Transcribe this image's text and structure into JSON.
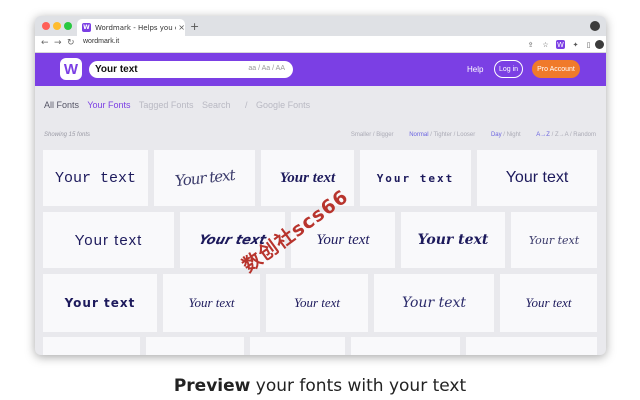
{
  "browser": {
    "tab_title": "Wordmark - Helps you choose",
    "tab_close": "×",
    "new_tab": "+",
    "url": "wordmark.it",
    "nav": {
      "back": "←",
      "forward": "→",
      "reload": "↻"
    },
    "favicon_letter": "W"
  },
  "header": {
    "logo_letter": "W",
    "search_value": "Your text",
    "case_options": "aa / Aa / AA",
    "help": "Help",
    "login": "Log in",
    "pro": "Pro Account",
    "colors": {
      "brand": "#7b3fe4",
      "pro": "#f07a2a"
    }
  },
  "filters": {
    "all_fonts": "All Fonts",
    "your_fonts": "Your Fonts",
    "tagged_fonts": "Tagged Fonts",
    "search": "Search",
    "separator": "/",
    "google_fonts": "Google Fonts"
  },
  "status": {
    "showing": "Showing 15 fonts",
    "size": "Smaller / Bigger",
    "spacing_normal": "Normal",
    "spacing_rest": "/ Tighter / Looser",
    "theme_day": "Day",
    "theme_rest": "/ Night",
    "sort_az": "A→Z",
    "sort_rest": "/ Z→A / Random"
  },
  "preview_text": "Your text",
  "watermark": "数创社scs66",
  "caption": {
    "bold": "Preview",
    "rest": " your fonts with your text"
  }
}
